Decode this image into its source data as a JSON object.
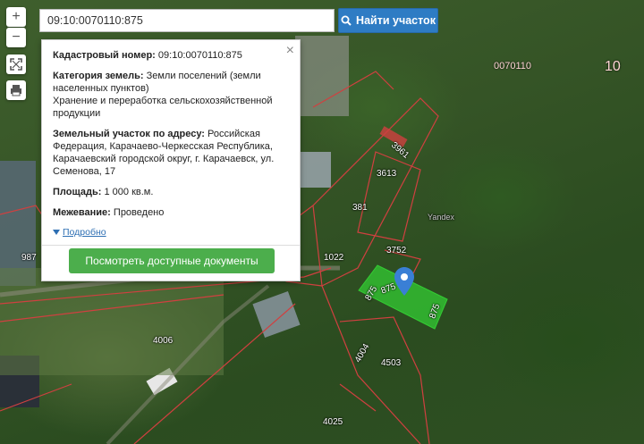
{
  "search": {
    "value": "09:10:0070110:875",
    "button_label": "Найти участок"
  },
  "controls": {
    "zoom_in": "+",
    "zoom_out": "−"
  },
  "popup": {
    "cadastral_label": "Кадастровый номер:",
    "cadastral_value": "09:10:0070110:875",
    "category_label": "Категория земель:",
    "category_value": "Земли поселений (земли населенных пунктов)",
    "usage_value": "Хранение и переработка сельскохозяйственной продукции",
    "address_label": "Земельный участок по адресу:",
    "address_value": "Российская Федерация, Карачаево-Черкесская Республика, Карачаевский городской округ, г. Карачаевск, ул. Семенова, 17",
    "area_label": "Площадь:",
    "area_value": "1 000 кв.м.",
    "survey_label": "Межевание:",
    "survey_value": "Проведено",
    "more_link": "Подробно",
    "docs_button": "Посмотреть доступные документы",
    "close": "×"
  },
  "map_labels": {
    "block": "0070110",
    "district": "10",
    "p3961": "3961",
    "p3613": "3613",
    "p381": "381",
    "p1022": "1022",
    "p3752": "3752",
    "p987": "987",
    "p4006": "4006",
    "p4004": "4004",
    "p4503": "4503",
    "p4025": "4025",
    "p875a": "875",
    "p875b": "875",
    "p875c": "875",
    "yandex": "Yandex"
  },
  "colors": {
    "accent_blue": "#2e7cc4",
    "docs_green": "#4cae4c",
    "parcel_green": "#33cc33",
    "boundary_red": "#d04040",
    "pin_blue": "#3a7fd5"
  }
}
